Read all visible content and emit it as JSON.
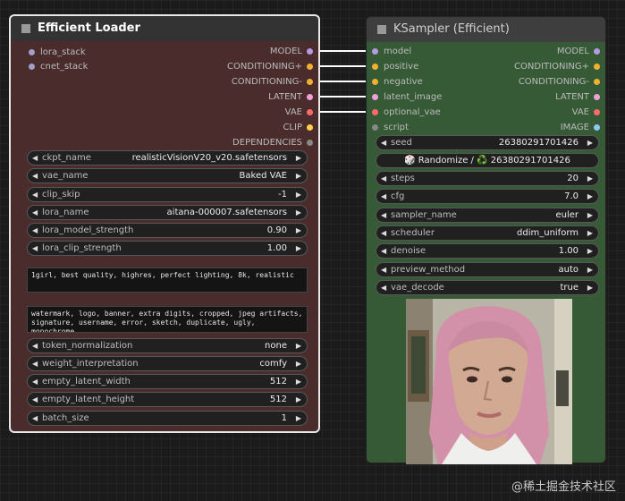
{
  "efficient_loader": {
    "title": "Efficient Loader",
    "inputs": [
      {
        "label": "lora_stack",
        "color": "#a0a0c8"
      },
      {
        "label": "cnet_stack",
        "color": "#a0a0c8"
      }
    ],
    "outputs": [
      {
        "label": "MODEL",
        "color": "#b49ae0"
      },
      {
        "label": "CONDITIONING+",
        "color": "#f0b030"
      },
      {
        "label": "CONDITIONING-",
        "color": "#f0b030"
      },
      {
        "label": "LATENT",
        "color": "#f0a0d8"
      },
      {
        "label": "VAE",
        "color": "#ff6b6b"
      },
      {
        "label": "CLIP",
        "color": "#ffd24a"
      },
      {
        "label": "DEPENDENCIES",
        "color": "#888888"
      }
    ],
    "widgets": [
      {
        "label": "ckpt_name",
        "value": "realisticVisionV20_v20.safetensors"
      },
      {
        "label": "vae_name",
        "value": "Baked VAE"
      },
      {
        "label": "clip_skip",
        "value": "-1"
      },
      {
        "label": "lora_name",
        "value": "aitana-000007.safetensors"
      },
      {
        "label": "lora_model_strength",
        "value": "0.90"
      },
      {
        "label": "lora_clip_strength",
        "value": "1.00"
      }
    ],
    "positive_prompt": "1girl, best quality, highres, perfect lighting, 8k, realistic",
    "negative_prompt": "watermark, logo, banner, extra digits, cropped, jpeg artifacts,\nsignature, username, error, sketch, duplicate, ugly, monochrome,\nhorror, geometry, mutation, disgusting",
    "widgets2": [
      {
        "label": "token_normalization",
        "value": "none"
      },
      {
        "label": "weight_interpretation",
        "value": "comfy"
      },
      {
        "label": "empty_latent_width",
        "value": "512"
      },
      {
        "label": "empty_latent_height",
        "value": "512"
      },
      {
        "label": "batch_size",
        "value": "1"
      }
    ]
  },
  "ksampler": {
    "title": "KSampler (Efficient)",
    "inputs": [
      {
        "label": "model",
        "color": "#b49ae0"
      },
      {
        "label": "positive",
        "color": "#f0b030"
      },
      {
        "label": "negative",
        "color": "#f0b030"
      },
      {
        "label": "latent_image",
        "color": "#f0a0d8"
      },
      {
        "label": "optional_vae",
        "color": "#ff6b6b"
      },
      {
        "label": "script",
        "color": "#888888"
      }
    ],
    "outputs": [
      {
        "label": "MODEL",
        "color": "#b49ae0"
      },
      {
        "label": "CONDITIONING+",
        "color": "#f0b030"
      },
      {
        "label": "CONDITIONING-",
        "color": "#f0b030"
      },
      {
        "label": "LATENT",
        "color": "#f0a0d8"
      },
      {
        "label": "VAE",
        "color": "#ff6b6b"
      },
      {
        "label": "IMAGE",
        "color": "#8fc7f0"
      }
    ],
    "seed": {
      "label": "seed",
      "value": "26380291701426"
    },
    "randomize_button": "🎲 Randomize / ♻️ 26380291701426",
    "widgets": [
      {
        "label": "steps",
        "value": "20"
      },
      {
        "label": "cfg",
        "value": "7.0"
      },
      {
        "label": "sampler_name",
        "value": "euler"
      },
      {
        "label": "scheduler",
        "value": "ddim_uniform"
      },
      {
        "label": "denoise",
        "value": "1.00"
      },
      {
        "label": "preview_method",
        "value": "auto"
      },
      {
        "label": "vae_decode",
        "value": "true"
      }
    ]
  },
  "watermark": "@稀土掘金技术社区"
}
